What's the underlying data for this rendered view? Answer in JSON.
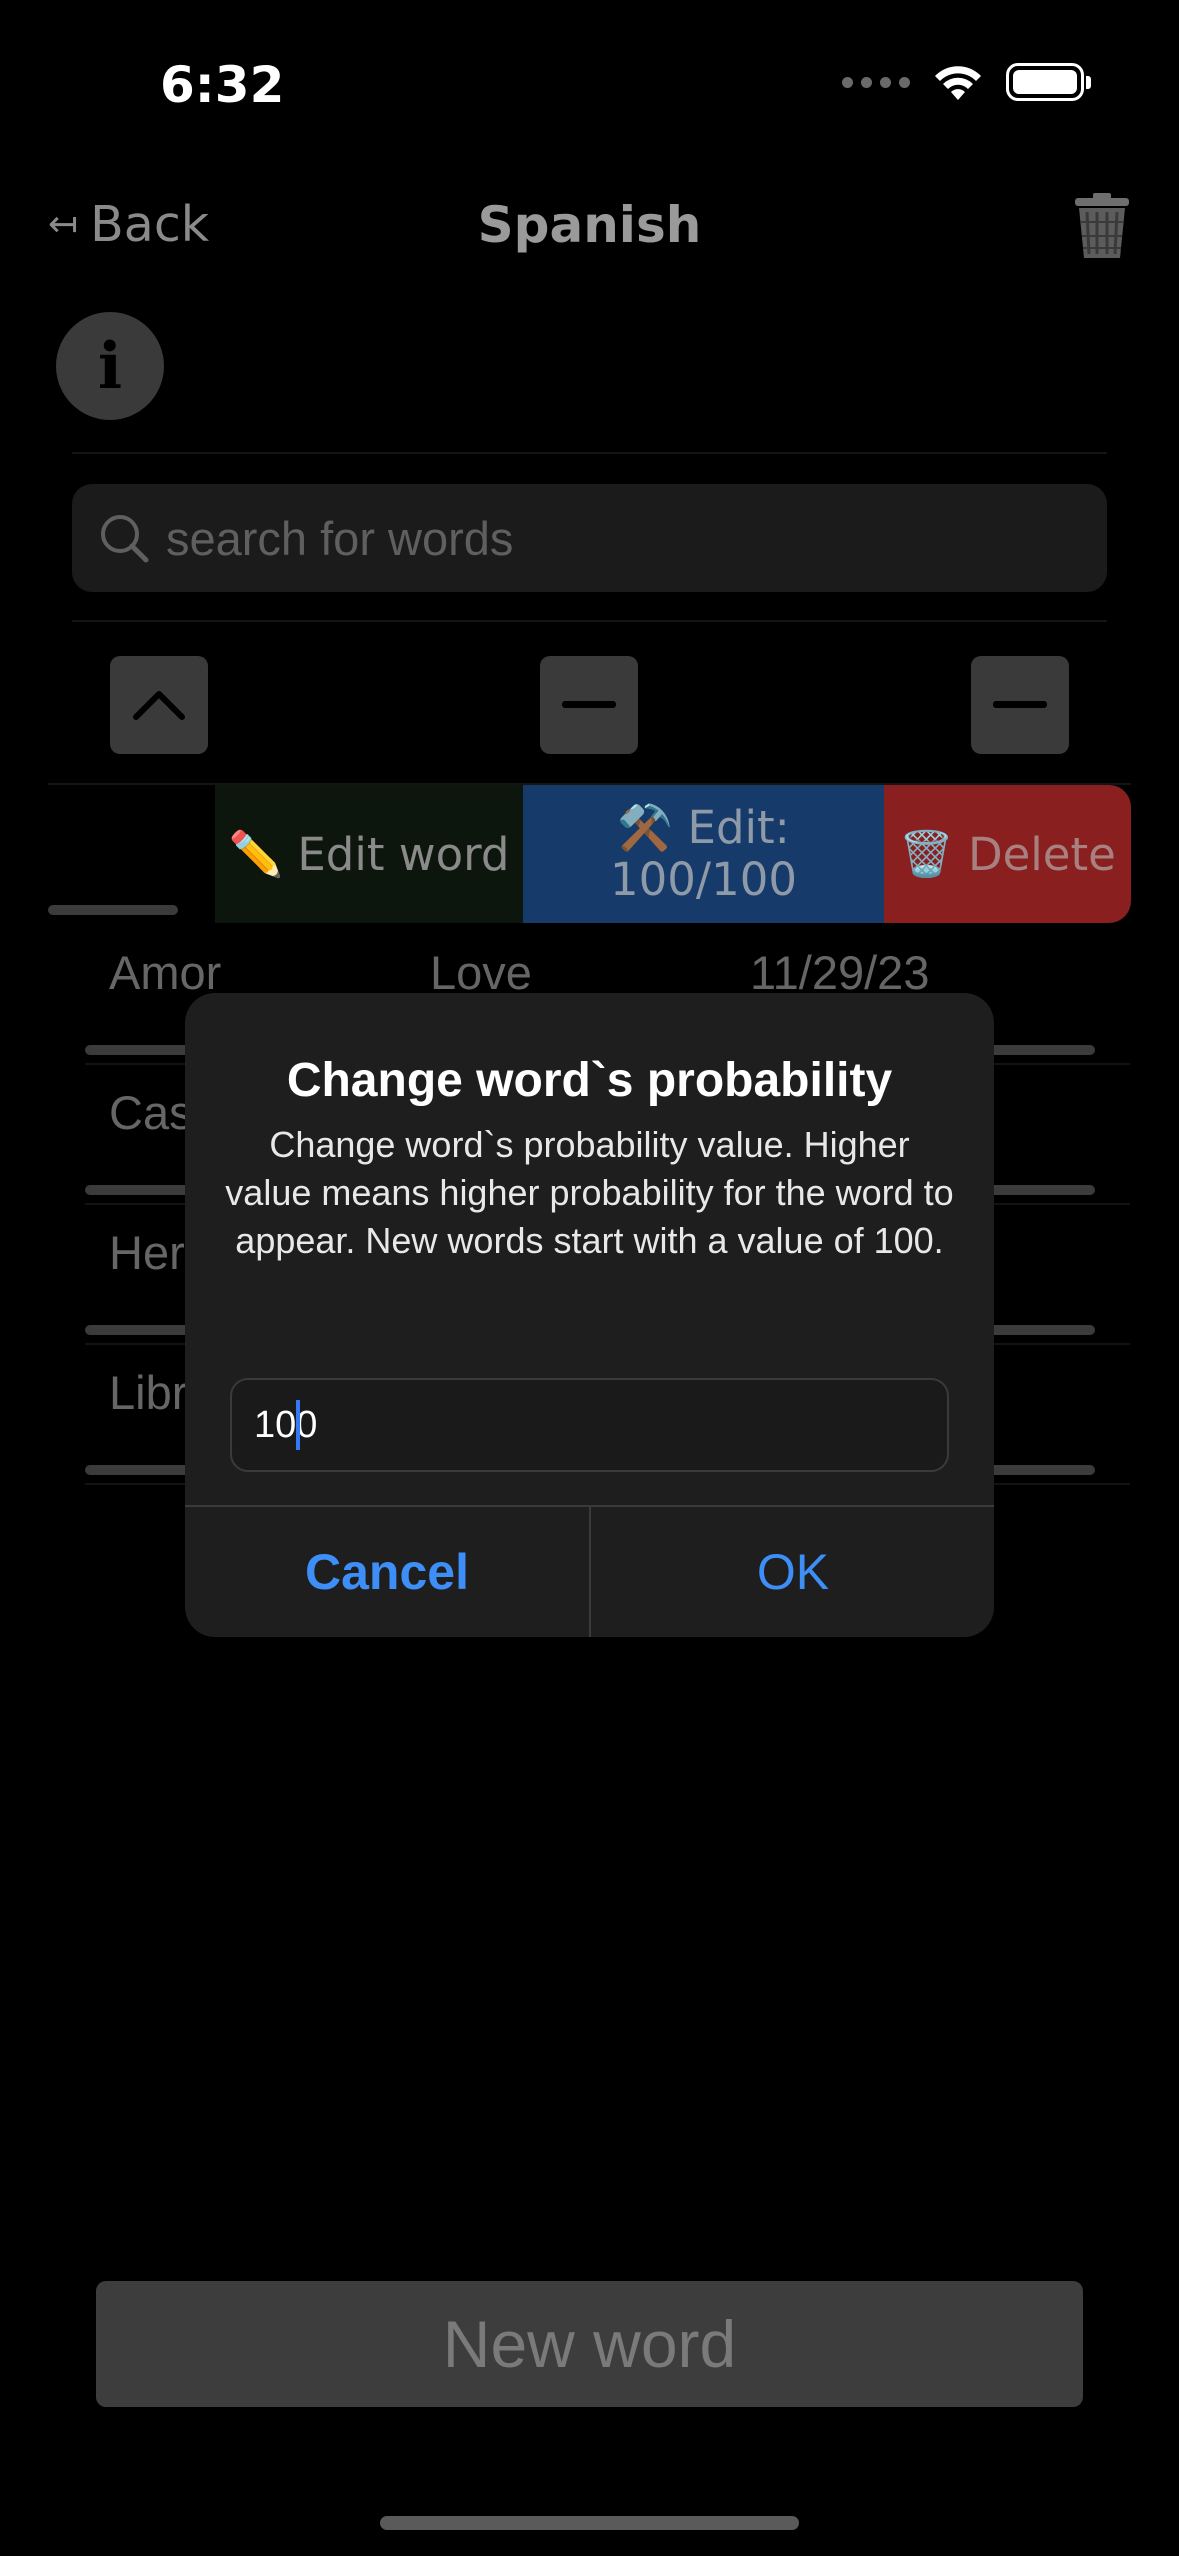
{
  "status_bar": {
    "time": "6:32"
  },
  "nav": {
    "back_label": "Back",
    "back_arrow": "↤",
    "title": "Spanish",
    "trash_icon": "trash-icon"
  },
  "info": {
    "glyph": "i"
  },
  "search": {
    "placeholder": "search for words",
    "value": ""
  },
  "swipe_actions": {
    "edit_word_emoji": "✏️",
    "edit_word_label": "Edit word",
    "edit_prob_emoji": "⚒️",
    "edit_prob_label": "Edit:",
    "edit_prob_value": "100/100",
    "delete_emoji": "🗑️",
    "delete_label": "Delete"
  },
  "words": [
    {
      "word": "Amor",
      "translation": "Love",
      "date": "11/29/23"
    },
    {
      "word": "Cas",
      "translation": "",
      "date": ""
    },
    {
      "word": "Her",
      "translation": "",
      "date": ""
    },
    {
      "word": "Libr",
      "translation": "",
      "date": ""
    }
  ],
  "alert": {
    "title": "Change word`s probability",
    "message": "Change word`s probability value. Higher value means higher probability for the word to appear. New words start with a value of 100.",
    "input_value": "100",
    "cancel_label": "Cancel",
    "ok_label": "OK",
    "accent_color": "#3d8ef6"
  },
  "footer": {
    "new_word_label": "New word"
  }
}
